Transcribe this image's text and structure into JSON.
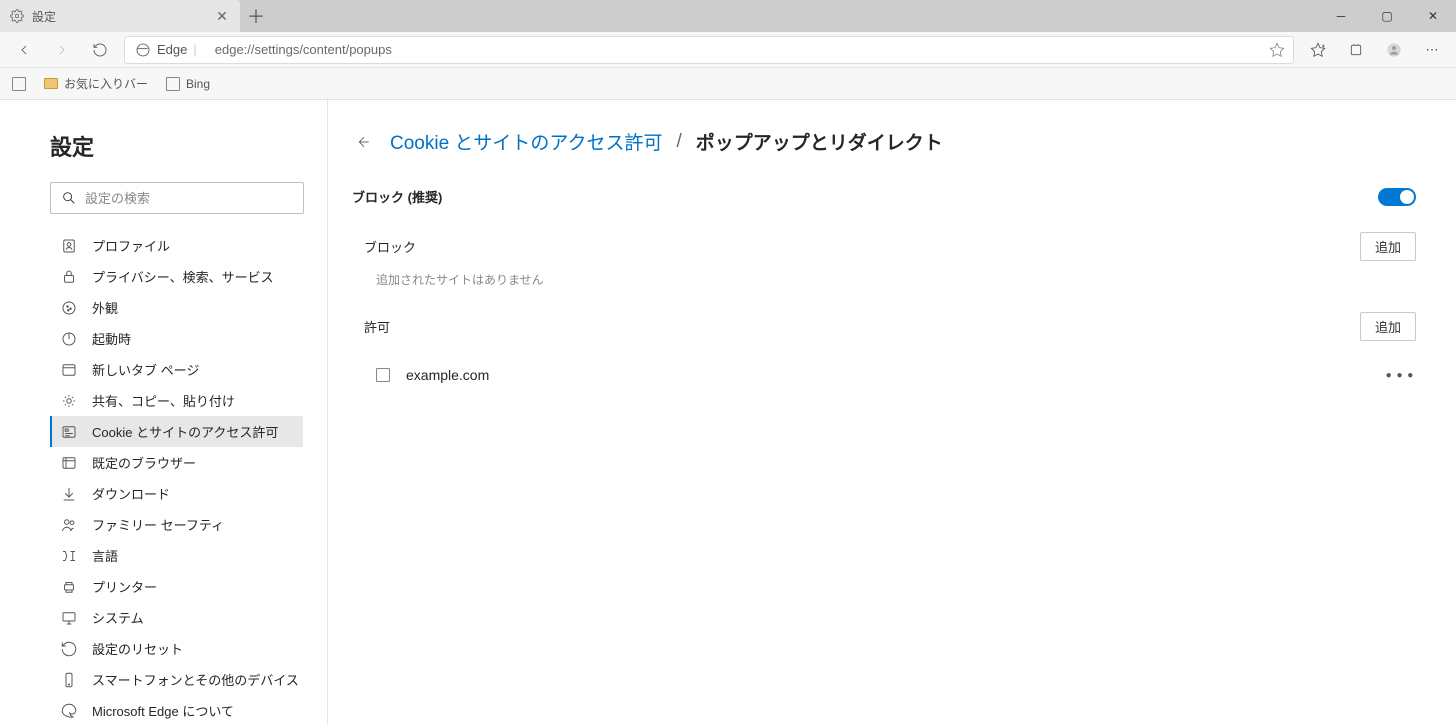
{
  "tab": {
    "title": "設定"
  },
  "address": {
    "edge_label": "Edge",
    "url": "edge://settings/content/popups"
  },
  "bookmarks": {
    "fav_bar": "お気に入りバー",
    "bing": "Bing"
  },
  "sidebar": {
    "title": "設定",
    "search_placeholder": "設定の検索",
    "items": [
      {
        "label": "プロファイル"
      },
      {
        "label": "プライバシー、検索、サービス"
      },
      {
        "label": "外観"
      },
      {
        "label": "起動時"
      },
      {
        "label": "新しいタブ ページ"
      },
      {
        "label": "共有、コピー、貼り付け"
      },
      {
        "label": "Cookie とサイトのアクセス許可"
      },
      {
        "label": "既定のブラウザー"
      },
      {
        "label": "ダウンロード"
      },
      {
        "label": "ファミリー セーフティ"
      },
      {
        "label": "言語"
      },
      {
        "label": "プリンター"
      },
      {
        "label": "システム"
      },
      {
        "label": "設定のリセット"
      },
      {
        "label": "スマートフォンとその他のデバイス"
      },
      {
        "label": "Microsoft Edge について"
      }
    ]
  },
  "main": {
    "breadcrumb_link": "Cookie とサイトのアクセス許可",
    "breadcrumb_sep": "/",
    "breadcrumb_current": "ポップアップとリダイレクト",
    "block_toggle_label": "ブロック (推奨)",
    "block_section": "ブロック",
    "block_empty": "追加されたサイトはありません",
    "allow_section": "許可",
    "add_button": "追加",
    "allowed_sites": [
      {
        "name": "example.com"
      }
    ]
  }
}
